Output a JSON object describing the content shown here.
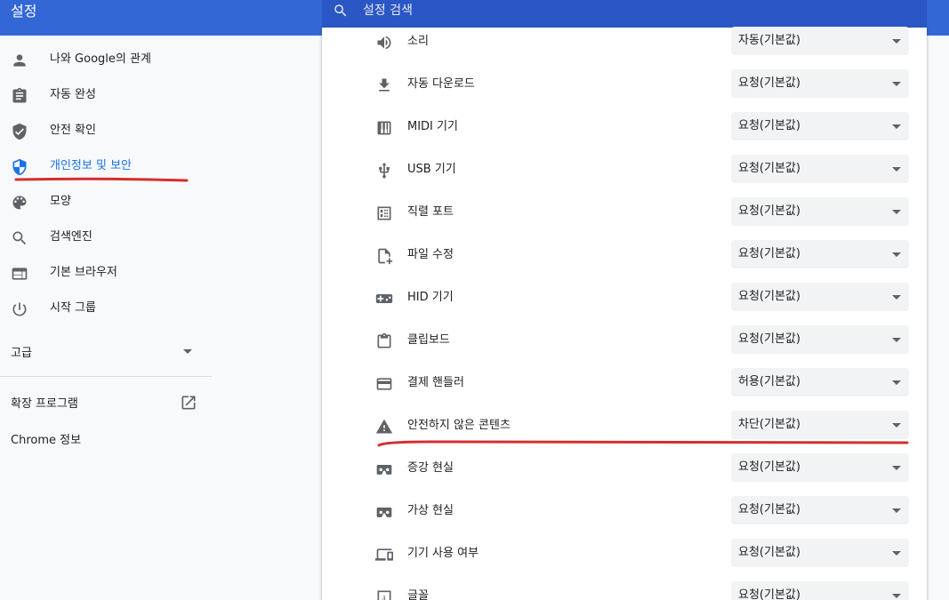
{
  "header": {
    "title": "설정",
    "search_placeholder": "설정 검색"
  },
  "sidebar": {
    "items": [
      {
        "label": "나와 Google의 관계",
        "icon": "person-icon"
      },
      {
        "label": "자동 완성",
        "icon": "assignment-icon"
      },
      {
        "label": "안전 확인",
        "icon": "shield-check-icon"
      },
      {
        "label": "개인정보 및 보안",
        "icon": "security-shield-icon",
        "active": true
      },
      {
        "label": "모양",
        "icon": "palette-icon"
      },
      {
        "label": "검색엔진",
        "icon": "search-icon"
      },
      {
        "label": "기본 브라우저",
        "icon": "browser-icon"
      },
      {
        "label": "시작 그룹",
        "icon": "power-icon"
      }
    ],
    "advanced_label": "고급",
    "extensions_label": "확장 프로그램",
    "about_label": "Chrome 정보"
  },
  "site_settings": [
    {
      "label": "소리",
      "icon": "volume-icon",
      "value": "자동(기본값)"
    },
    {
      "label": "자동 다운로드",
      "icon": "download-icon",
      "value": "요청(기본값)"
    },
    {
      "label": "MIDI 기기",
      "icon": "piano-icon",
      "value": "요청(기본값)"
    },
    {
      "label": "USB 기기",
      "icon": "usb-icon",
      "value": "요청(기본값)"
    },
    {
      "label": "직렬 포트",
      "icon": "serial-port-icon",
      "value": "요청(기본값)"
    },
    {
      "label": "파일 수정",
      "icon": "file-save-icon",
      "value": "요청(기본값)"
    },
    {
      "label": "HID 기기",
      "icon": "gamepad-icon",
      "value": "요청(기본값)"
    },
    {
      "label": "클립보드",
      "icon": "clipboard-icon",
      "value": "요청(기본값)"
    },
    {
      "label": "결제 핸들러",
      "icon": "credit-card-icon",
      "value": "허용(기본값)"
    },
    {
      "label": "안전하지 않은 콘텐츠",
      "icon": "warning-icon",
      "value": "차단(기본값)"
    },
    {
      "label": "증강 현실",
      "icon": "vr-headset-icon",
      "value": "요청(기본값)"
    },
    {
      "label": "가상 현실",
      "icon": "vr-headset-icon",
      "value": "요청(기본값)"
    },
    {
      "label": "기기 사용 여부",
      "icon": "devices-icon",
      "value": "요청(기본값)"
    },
    {
      "label": "글꼴",
      "icon": "font-icon",
      "value": "요청(기본값)"
    }
  ],
  "colors": {
    "header_bg": "#3367d6",
    "accent": "#1a73e8",
    "annotation_red": "#d32f2f"
  }
}
